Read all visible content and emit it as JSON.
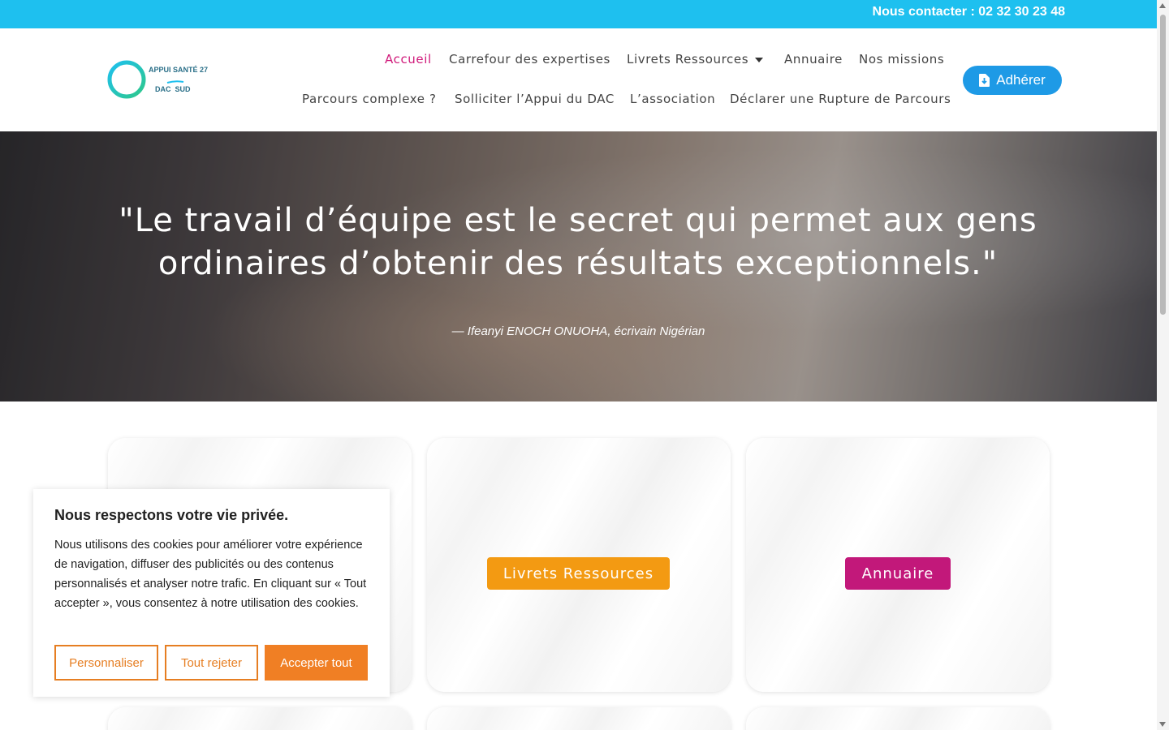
{
  "topbar": {
    "contact": "Nous contacter : 02 32 30 23 48"
  },
  "logo": {
    "line1": "APPUI SANTÉ 27",
    "line2": "DAC  SUD",
    "icon": "ring-logo-icon"
  },
  "nav": {
    "row1": [
      {
        "label": "Accueil",
        "active": true
      },
      {
        "label": "Carrefour des expertises"
      },
      {
        "label": "Livrets Ressources",
        "has_dropdown": true
      },
      {
        "label": "Annuaire"
      },
      {
        "label": "Nos missions"
      }
    ],
    "row2": [
      {
        "label": "Parcours complexe ?"
      },
      {
        "label": "Solliciter l’Appui du DAC"
      },
      {
        "label": "L’association"
      },
      {
        "label": "Déclarer une Rupture de Parcours"
      }
    ],
    "cta": {
      "label": "Adhérer",
      "icon": "file-download-icon"
    }
  },
  "hero": {
    "quote": "\"Le travail d’équipe est le secret qui permet aux gens ordinaires d’obtenir des résultats exceptionnels.\"",
    "author": "— Ifeanyi ENOCH ONUOHA, écrivain Nigérian"
  },
  "cards": [
    {
      "button": "Livrets Ressources",
      "color": "#f39a12"
    },
    {
      "button": "Annuaire",
      "color": "#c2187a"
    }
  ],
  "cookie": {
    "title": "Nous respectons votre vie privée.",
    "text": "Nous utilisons des cookies pour améliorer votre expérience de navigation, diffuser des publicités ou des contenus personnalisés et analyser notre trafic. En cliquant sur « Tout accepter », vous consentez à notre utilisation des cookies.",
    "customize": "Personnaliser",
    "reject": "Tout rejeter",
    "accept": "Accepter tout"
  },
  "colors": {
    "topbar": "#1ec0ef",
    "accent": "#d0197a",
    "cta": "#1e9ae6",
    "cookie_accent": "#f07f24"
  }
}
